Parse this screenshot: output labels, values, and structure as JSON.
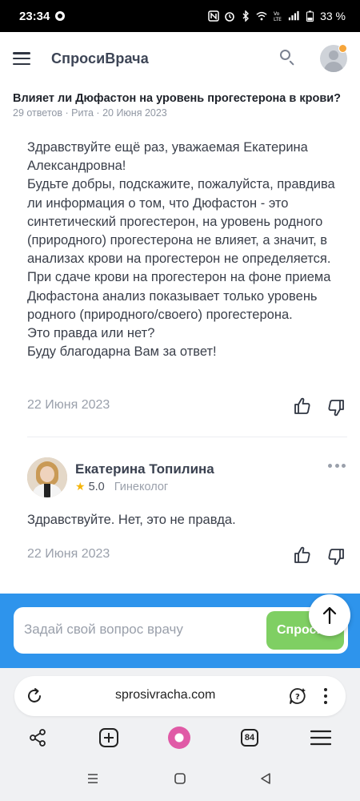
{
  "status_bar": {
    "time": "23:34",
    "battery": "33 %"
  },
  "header": {
    "brand": "СпросиВрача",
    "menu_icon": "hamburger-menu-icon",
    "search_icon": "search-icon",
    "avatar_icon": "user-avatar-icon",
    "notification_color": "#f6a53a"
  },
  "question": {
    "title": "Влияет ли Дюфастон на уровень прогестерона в крови?",
    "meta": "29 ответов · Рита · 20 Июня 2023"
  },
  "message": {
    "text": "Здравствуйте ещё раз, уважаемая Екатерина Александровна!\nБудьте добры, подскажите, пожалуйста, правдива ли информация о том, что Дюфастон - это синтетический прогестерон, на уровень родного (природного) прогестерона не влияет, а значит, в анализах крови на прогестерон не определяется. При сдаче крови на прогестерон на фоне приема Дюфастона анализ показывает только уровень родного (природного/своего) прогестерона.\nЭто правда или нет?\nБуду благодарна Вам за ответ!",
    "date": "22 Июня 2023"
  },
  "answer": {
    "doctor_name": "Екатерина Топилина",
    "rating": "5.0",
    "specialty": "Гинеколог",
    "text": "Здравствуйте. Нет, это не правда.",
    "date": "22 Июня 2023"
  },
  "ask": {
    "placeholder": "Задай свой вопрос врачу",
    "button_label": "Спроси",
    "panel_color": "#2e94ec",
    "button_color": "#7fcf63"
  },
  "browser": {
    "url": "sprosivracha.com",
    "tabs_count": "84"
  }
}
